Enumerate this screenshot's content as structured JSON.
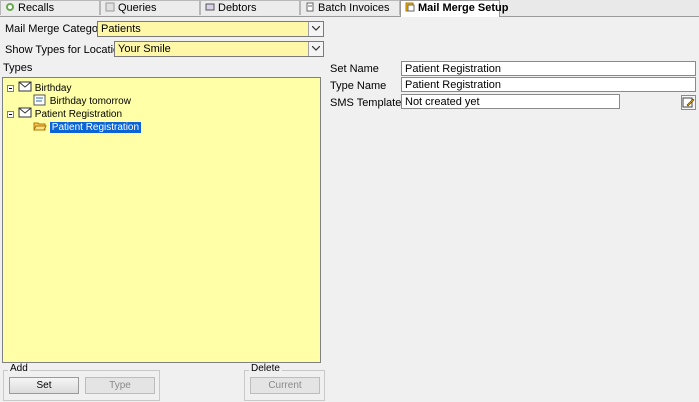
{
  "tabs": [
    {
      "label": "Recalls",
      "icon": "recalls-icon"
    },
    {
      "label": "Queries",
      "icon": "queries-icon"
    },
    {
      "label": "Debtors",
      "icon": "debtors-icon"
    },
    {
      "label": "Batch Invoices",
      "icon": "batch-invoices-icon"
    },
    {
      "label": "Mail Merge Setup",
      "icon": "mail-merge-icon"
    }
  ],
  "form": {
    "category_label": "Mail Merge Category",
    "category_value": "Patients",
    "location_label": "Show Types for Location",
    "location_value": "Your Smile",
    "types_label": "Types"
  },
  "tree": [
    {
      "label": "Birthday",
      "children": [
        {
          "label": "Birthday tomorrow"
        }
      ]
    },
    {
      "label": "Patient Registration",
      "children": [
        {
          "label": "Patient Registration",
          "selected": true
        }
      ]
    }
  ],
  "details": {
    "set_name_label": "Set Name",
    "set_name_value": "Patient Registration",
    "type_name_label": "Type Name",
    "type_name_value": "Patient Registration",
    "sms_label": "SMS Template",
    "sms_value": "Not created yet"
  },
  "add_group": {
    "title": "Add",
    "set_label": "Set",
    "type_label": "Type"
  },
  "delete_group": {
    "title": "Delete",
    "current_label": "Current"
  },
  "colors": {
    "field_yellow": "#fff7a8",
    "tree_yellow": "#ffffa8",
    "selection": "#0a64d6"
  }
}
